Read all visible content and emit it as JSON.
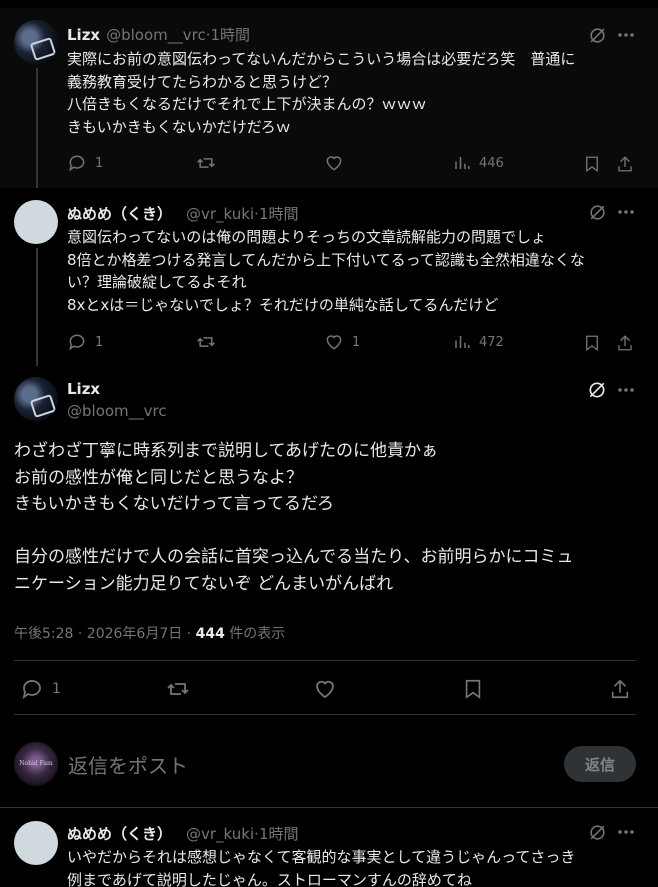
{
  "tweets": [
    {
      "name": "Lizx",
      "handle": "@bloom__vrc",
      "time": "1時間",
      "lines": [
        "実際にお前の意図伝わってないんだからこういう場合は必要だろ笑　普通に",
        "義務教育受けてたらわかると思うけど？",
        "八倍きもくなるだけでそれで上下が決まんの？ｗｗｗ",
        "きもいかきもくないかだけだろｗ"
      ],
      "replies": "1",
      "retweets": "",
      "likes": "",
      "views": "446"
    },
    {
      "name": "ぬめめ（くき）",
      "handle": "@vr_kuki",
      "time": "1時間",
      "lines": [
        "意図伝わってないのは俺の問題よりそっちの文章読解能力の問題でしょ",
        "8倍とか格差つける発言してんだから上下付いてるって認識も全然相違なくな",
        "い？理論破綻してるよそれ",
        "8xとxは＝じゃないでしょ？それだけの単純な話してるんだけど"
      ],
      "replies": "1",
      "retweets": "",
      "likes": "1",
      "views": "472"
    }
  ],
  "main": {
    "name": "Lizx",
    "handle": "@bloom__vrc",
    "lines": [
      "わざわざ丁寧に時系列まで説明してあげたのに他責かぁ",
      "お前の感性が俺と同じだと思うなよ？",
      "きもいかきもくないだけって言ってるだろ",
      "",
      "自分の感性だけで人の会話に首突っ込んでる当たり、お前明らかにコミュ",
      "ニケーション能力足りてないぞ どんまいがんばれ"
    ],
    "timestamp": "午後5:28 · 2026年6月7日 · ",
    "views_count": "444",
    "views_label": " 件の表示",
    "replies": "1"
  },
  "reply_box": {
    "placeholder": "返信をポスト",
    "button": "返信",
    "avatar_text": "Nohid Fam"
  },
  "next_tweet": {
    "name": "ぬめめ（くき）",
    "handle": "@vr_kuki",
    "time": "1時間",
    "lines": [
      "いやだからそれは感想じゃなくて客観的な事実として違うじゃんってさっき",
      "例まであげて説明したじゃん。ストローマンすんの辞めてね"
    ]
  },
  "separator": " · ",
  "icons": [
    "grok-icon",
    "more-icon",
    "reply-icon",
    "retweet-icon",
    "like-icon",
    "views-icon",
    "bookmark-icon",
    "share-icon"
  ]
}
